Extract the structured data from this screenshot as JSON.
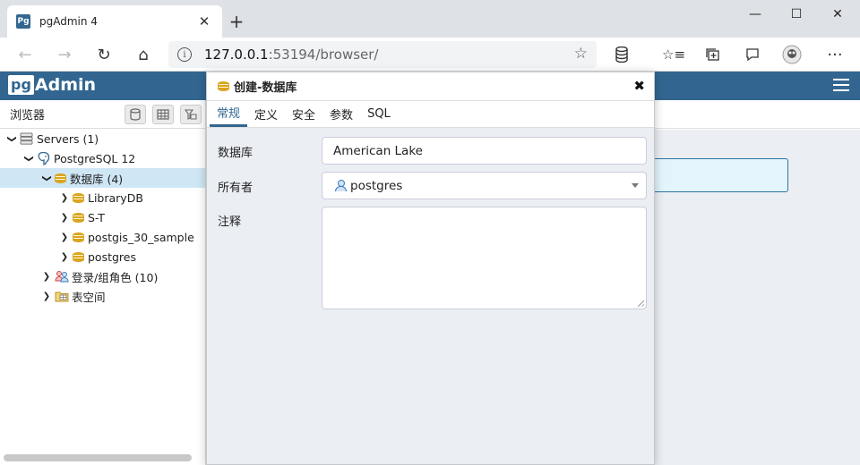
{
  "browser": {
    "tab_title": "pgAdmin 4",
    "favicon_text": "Pg",
    "url_host": "127.0.0.1",
    "url_rest": ":53194/browser/"
  },
  "app": {
    "logo_pg": "pg",
    "logo_admin": "Admin",
    "header_color": "#326690"
  },
  "browser_panel": {
    "title": "浏览器",
    "tree": [
      {
        "label": "Servers (1)",
        "icon": "servers-icon",
        "depth": 0,
        "expanded": true
      },
      {
        "label": "PostgreSQL 12",
        "icon": "postgresql-elephant-icon",
        "depth": 1,
        "expanded": true
      },
      {
        "label": "数据库 (4)",
        "icon": "database-icon",
        "depth": 2,
        "expanded": true,
        "selected": true
      },
      {
        "label": "LibraryDB",
        "icon": "database-icon",
        "depth": 3,
        "expanded": false
      },
      {
        "label": "S-T",
        "icon": "database-icon",
        "depth": 3,
        "expanded": false
      },
      {
        "label": "postgis_30_sample",
        "icon": "database-icon",
        "depth": 3,
        "expanded": false
      },
      {
        "label": "postgres",
        "icon": "database-icon",
        "depth": 3,
        "expanded": false
      },
      {
        "label": "登录/组角色 (10)",
        "icon": "login-roles-icon",
        "depth": 2,
        "expanded": false
      },
      {
        "label": "表空间",
        "icon": "tablespaces-icon",
        "depth": 2,
        "expanded": false
      }
    ]
  },
  "dialog": {
    "title": "创建-数据库",
    "tabs": [
      "常规",
      "定义",
      "安全",
      "参数",
      "SQL"
    ],
    "active_tab": "常规",
    "fields": {
      "database_label": "数据库",
      "database_value": "American Lake",
      "owner_label": "所有者",
      "owner_value": "postgres",
      "comment_label": "注释",
      "comment_value": ""
    }
  }
}
